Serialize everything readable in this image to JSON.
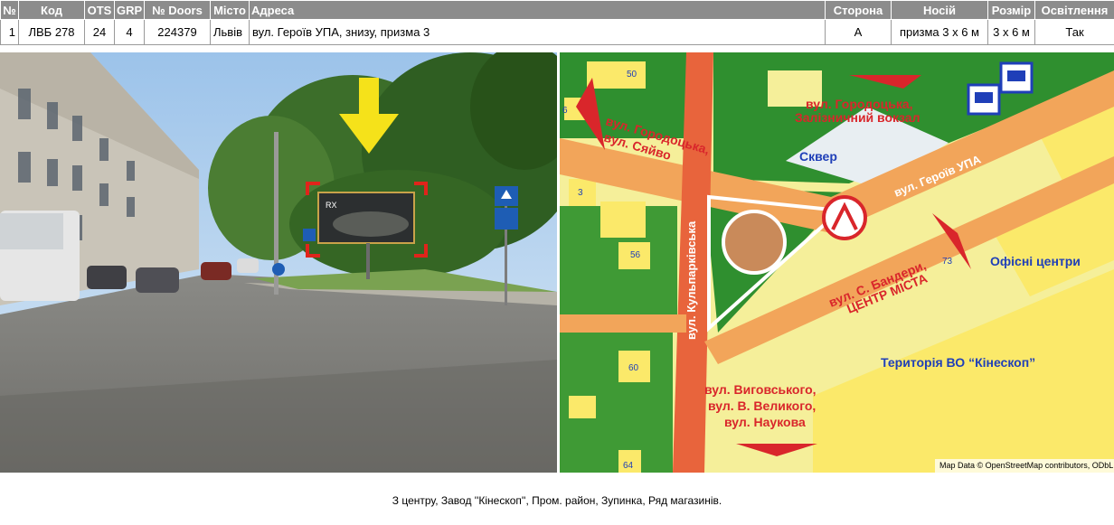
{
  "table": {
    "headers": [
      "№",
      "Код",
      "OTS",
      "GRP",
      "№ Doors",
      "Місто",
      "Адреса",
      "Сторона",
      "Носій",
      "Розмір",
      "Освітлення"
    ],
    "row": {
      "num": "1",
      "code": "ЛВБ 278",
      "ots": "24",
      "grp": "4",
      "doors": "224379",
      "city": "Львів",
      "address": "вул. Героїв УПА, знизу, призма 3",
      "side": "А",
      "carrier": "призма 3 х 6 м",
      "size": "3 х 6 м",
      "lighting": "Так"
    }
  },
  "photo": {
    "billboard_text": "RX"
  },
  "map": {
    "labels": {
      "gorodotska_left": "вул. Городоцька,",
      "syaivo": "вул. Сяйво",
      "gorodotska_top": "вул. Городоцька,",
      "station": "Залізничний вокзал",
      "skver": "Сквер",
      "heroiv_upa": "вул. Героїв УПА",
      "kulparkivska": "вул. Кульпарківська",
      "bandery": "вул. С. Бандери,",
      "centre": "ЦЕНТР МІСТА",
      "offices": "Офісні центри",
      "kineskop": "Територія ВО “Кінескоп”",
      "vygovskoho": "вул. Виговського,",
      "velykoho": "вул. В. Великого,",
      "naukova": "вул. Наукова",
      "attribution": "Map Data © OpenStreetMap contributors, ODbL"
    },
    "house_numbers": [
      "50",
      "6",
      "3",
      "56",
      "73",
      "60",
      "64"
    ],
    "colors": {
      "road_major": "#e8643c",
      "road_orange": "#f2a55a",
      "block_yellow": "#fbe96a",
      "park_green": "#2f8f2f",
      "label_red": "#d9262b",
      "label_blue": "#1f3fb8"
    }
  },
  "caption": "З центру, Завод ''Кінескоп'', Пром. район, Зупинка, Ряд магазинів."
}
